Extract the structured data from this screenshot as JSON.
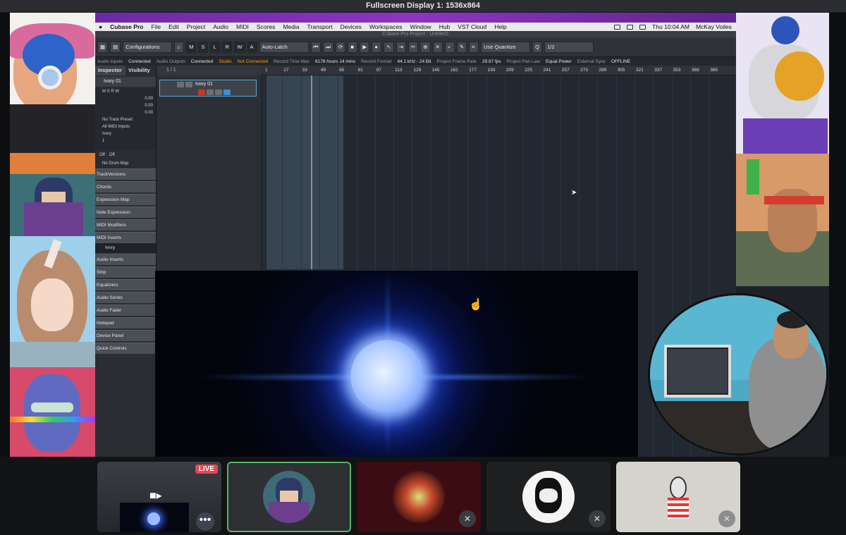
{
  "window": {
    "title": "Fullscreen Display 1: 1536x864"
  },
  "menubar": {
    "app": "Cubase Pro",
    "items": [
      "File",
      "Edit",
      "Project",
      "Audio",
      "MIDI",
      "Scores",
      "Media",
      "Transport",
      "Devices",
      "Workspaces",
      "Window",
      "Hub",
      "VST Cloud",
      "Help"
    ],
    "clock": "Thu 10:04 AM",
    "user": "McKay Voiles"
  },
  "project": {
    "title": "Cubase Pro Project - Untitled1",
    "toolbar": {
      "configurations": "Configurations",
      "automation_mode": "Auto-Latch",
      "quantize_label": "Use Quantize",
      "quantize_value": "1/2"
    },
    "status": {
      "audio_inputs_label": "Audio Inputs",
      "audio_inputs_value": "Connected",
      "audio_outputs_label": "Audio Outputs",
      "audio_outputs_value": "Connected",
      "studio_label": "Studio",
      "studio_value": "Not Connected",
      "record_time_label": "Record Time Max",
      "record_time_value": "6176 hours 14 mins",
      "record_format_label": "Record Format",
      "record_format_value": "44.1 kHz - 24 Bit",
      "frame_rate_label": "Project Frame Rate",
      "frame_rate_value": "29.97 fps",
      "pan_law_label": "Project Pan Law",
      "pan_law_value": "Equal Power",
      "sync_label": "External Sync",
      "sync_value": "OFFLINE"
    },
    "ruler_ticks": [
      "1",
      "17",
      "33",
      "49",
      "65",
      "81",
      "97",
      "113",
      "129",
      "145",
      "161",
      "177",
      "193",
      "209",
      "225",
      "241",
      "257",
      "273",
      "289",
      "305",
      "321",
      "337",
      "353",
      "369",
      "385"
    ],
    "tracklist_counter": "1 / 1"
  },
  "inspector": {
    "tabs": [
      "Inspector",
      "Visibility"
    ],
    "track_name": "Ivory 01",
    "volume": "0.00",
    "pan": "0.00",
    "delay": "0.00",
    "no_preset": "No Track Preset",
    "midi_input": "All MIDI Inputs",
    "instrument": "Ivory",
    "channel": "1",
    "bank": "Off",
    "program": "Off",
    "drum_map": "No Drum Map",
    "sections": [
      "TrackVersions",
      "Chords",
      "Expression Map",
      "Note Expression",
      "MIDI Modifiers",
      "MIDI Inserts"
    ],
    "insert_slot": "Ivory",
    "sections2": [
      "Audio Inserts",
      "Strip",
      "Equalizers",
      "Audio Sends",
      "Audio Fader",
      "Notepad",
      "Device Panel",
      "Quick Controls"
    ]
  },
  "track": {
    "name": "Ivory 01"
  },
  "participants": {
    "live_badge": "LIVE",
    "active_index": 1
  },
  "colors": {
    "accent_purple": "#8e34c1",
    "active_border": "#4fb867",
    "live_red": "#e64553",
    "status_orange": "#f0a21b"
  }
}
